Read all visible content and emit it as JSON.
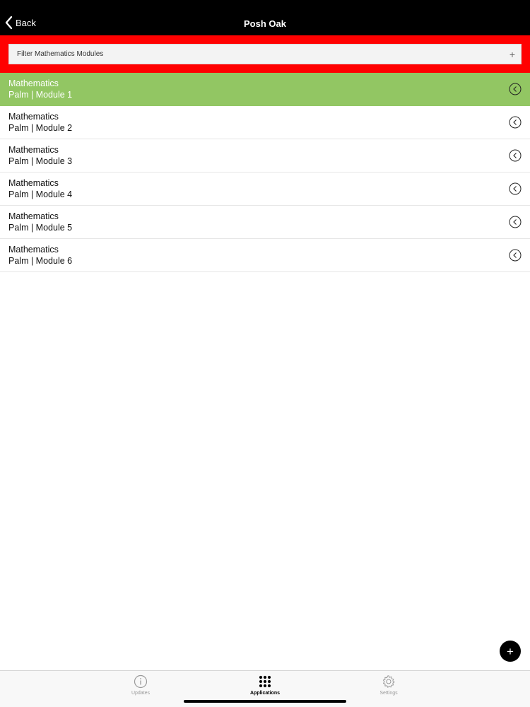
{
  "header": {
    "back_label": "Back",
    "title": "Posh Oak"
  },
  "filter": {
    "placeholder": "Filter Mathematics Modules",
    "add_symbol": "+"
  },
  "modules": [
    {
      "line1": "Mathematics",
      "line2": "Palm | Module 1",
      "selected": true
    },
    {
      "line1": "Mathematics",
      "line2": "Palm | Module 2",
      "selected": false
    },
    {
      "line1": "Mathematics",
      "line2": "Palm | Module 3",
      "selected": false
    },
    {
      "line1": "Mathematics",
      "line2": "Palm | Module 4",
      "selected": false
    },
    {
      "line1": "Mathematics",
      "line2": "Palm | Module 5",
      "selected": false
    },
    {
      "line1": "Mathematics",
      "line2": "Palm | Module 6",
      "selected": false
    }
  ],
  "fab": {
    "symbol": "+"
  },
  "tabs": [
    {
      "label": "Updates",
      "icon": "info-icon",
      "active": false
    },
    {
      "label": "Applications",
      "icon": "grid-icon",
      "active": true
    },
    {
      "label": "Settings",
      "icon": "gear-icon",
      "active": false
    }
  ],
  "colors": {
    "header_bg": "#000000",
    "filter_bar_bg": "#ff0000",
    "selected_row_bg": "#92c663"
  }
}
